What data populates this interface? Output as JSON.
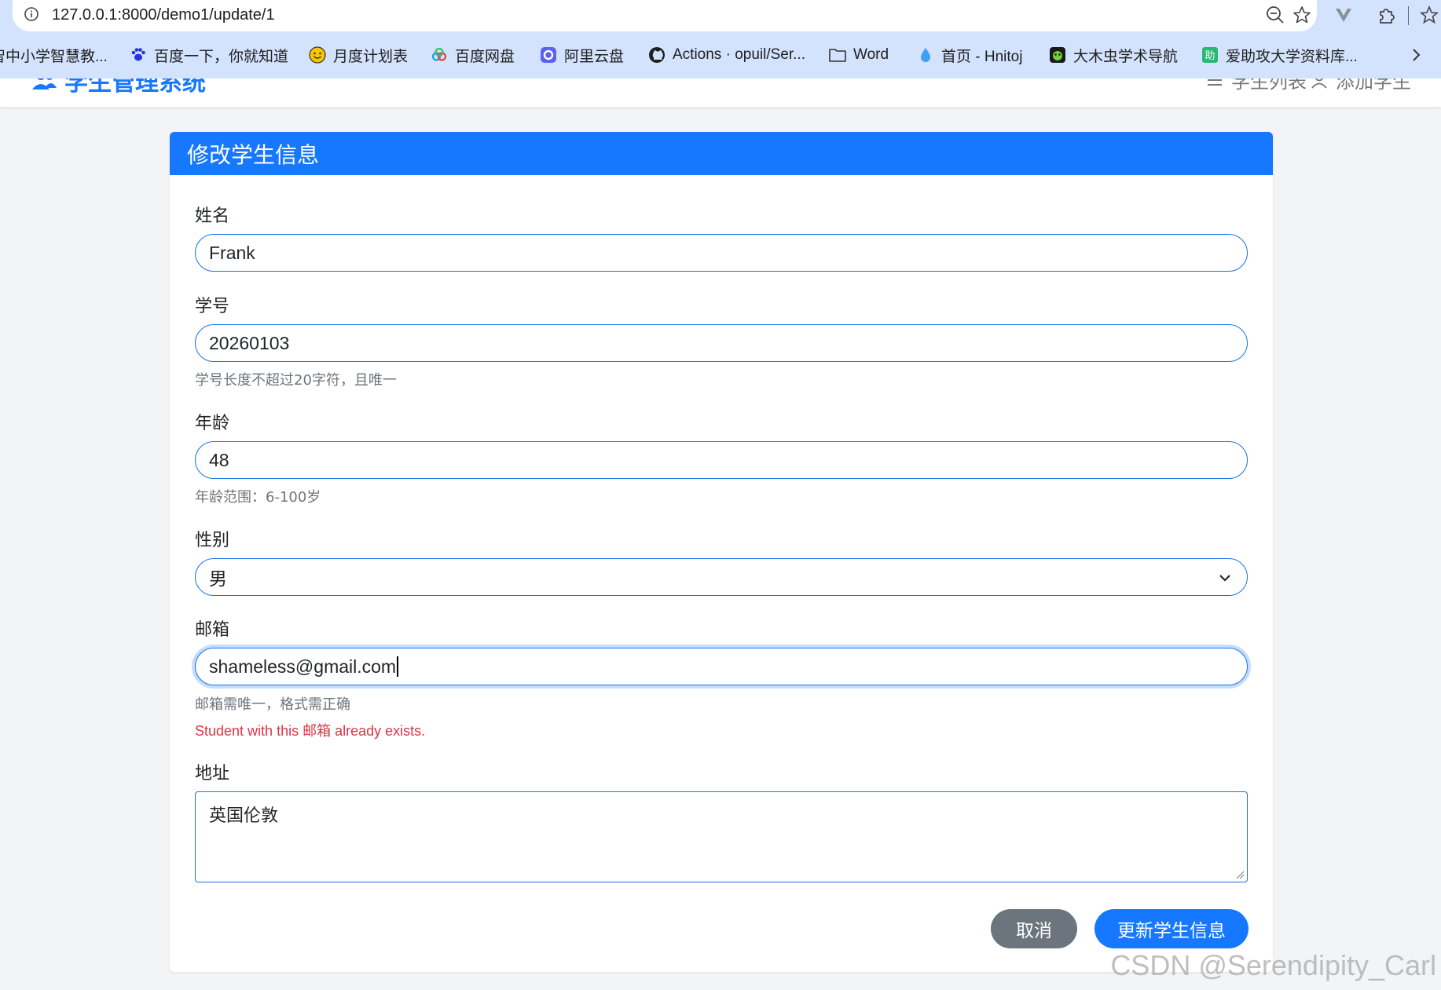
{
  "browser": {
    "url": "127.0.0.1:8000/demo1/update/1",
    "bookmarks": [
      {
        "label": "智中小学智慧教...",
        "icon": "none"
      },
      {
        "label": "百度一下，你就知道",
        "icon": "baidu-paw-icon"
      },
      {
        "label": "月度计划表",
        "icon": "smiley-icon"
      },
      {
        "label": "百度网盘",
        "icon": "cloud-drive-icon"
      },
      {
        "label": "阿里云盘",
        "icon": "aliyun-drive-icon"
      },
      {
        "label": "Actions · opuil/Ser...",
        "icon": "github-icon"
      },
      {
        "label": "Word",
        "icon": "folder-icon"
      },
      {
        "label": "首页 - Hnitoj",
        "icon": "water-drop-icon"
      },
      {
        "label": "大木虫学术导航",
        "icon": "bug-icon"
      },
      {
        "label": "爱助攻大学资料库...",
        "icon": "zhu-icon"
      }
    ]
  },
  "app": {
    "brand": "学生管理系统",
    "nav": [
      {
        "label": "学生列表",
        "icon": "list-icon"
      },
      {
        "label": "添加学生",
        "icon": "user-icon"
      }
    ]
  },
  "form": {
    "title": "修改学生信息",
    "name_label": "姓名",
    "name_value": "Frank",
    "sid_label": "学号",
    "sid_value": "20260103",
    "sid_help": "学号长度不超过20字符，且唯一",
    "age_label": "年龄",
    "age_value": "48",
    "age_help": "年龄范围：6-100岁",
    "gender_label": "性别",
    "gender_value": "男",
    "email_label": "邮箱",
    "email_value": "shameless@gmail.com",
    "email_help": "邮箱需唯一，格式需正确",
    "email_error": "Student with this 邮箱 already exists.",
    "address_label": "地址",
    "address_value": "英国伦敦",
    "cancel_label": "取消",
    "submit_label": "更新学生信息"
  },
  "watermark": "CSDN @Serendipity_Carl",
  "colors": {
    "primary": "#1677ff",
    "secondary": "#6c757d",
    "danger": "#dc3545",
    "chrome": "#d3e3fd"
  }
}
